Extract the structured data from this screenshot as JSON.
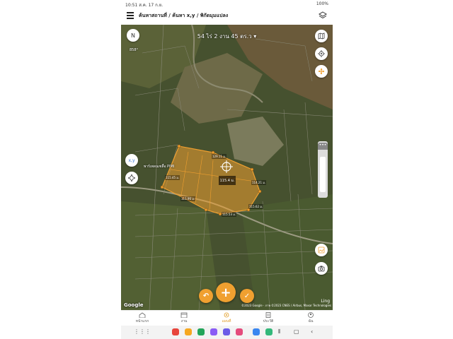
{
  "status_bar": {
    "time": "10:51",
    "date": "ส.ค. 17 ก.ย.",
    "battery": "100%"
  },
  "header": {
    "breadcrumb": "ค้นหาสถานที่ / ค้นหา x,y / พิกัดมุมแปลง",
    "menu_icon": "hamburger-menu-icon",
    "layers_icon": "layers-icon"
  },
  "map": {
    "area_label": "54 ไร่ 2 งาน 45 ตร.ว",
    "compass_label": "N",
    "scale_text": "858°",
    "place_label": "พาร์เพลนเซลื้อ PIMI",
    "center_distance": "115.4 ม.",
    "xy_button": "x,y",
    "segment_labels": [
      "129.11 ม.",
      "114.21 ม.",
      "115.62 ม.",
      "115.53 ม.",
      "115.96 ม.",
      "115.45 ม."
    ],
    "google": "Google",
    "copyright": "©2023 Google · ภาพ ©2023 CNES / Airbus, Maxar Technologies",
    "ling": "Ling",
    "parcel_color": "#f0a030"
  },
  "actions": {
    "undo_icon": "undo-icon",
    "add_icon": "plus-icon",
    "confirm_icon": "check-icon"
  },
  "bottom_nav": [
    {
      "label": "หน้าแรก",
      "icon": "home-icon"
    },
    {
      "label": "งาน",
      "icon": "calendar-icon"
    },
    {
      "label": "แผนที่",
      "icon": "map-pin-icon"
    },
    {
      "label": "ประวัติ",
      "icon": "history-icon"
    },
    {
      "label": "ฉัน",
      "icon": "profile-icon"
    }
  ]
}
